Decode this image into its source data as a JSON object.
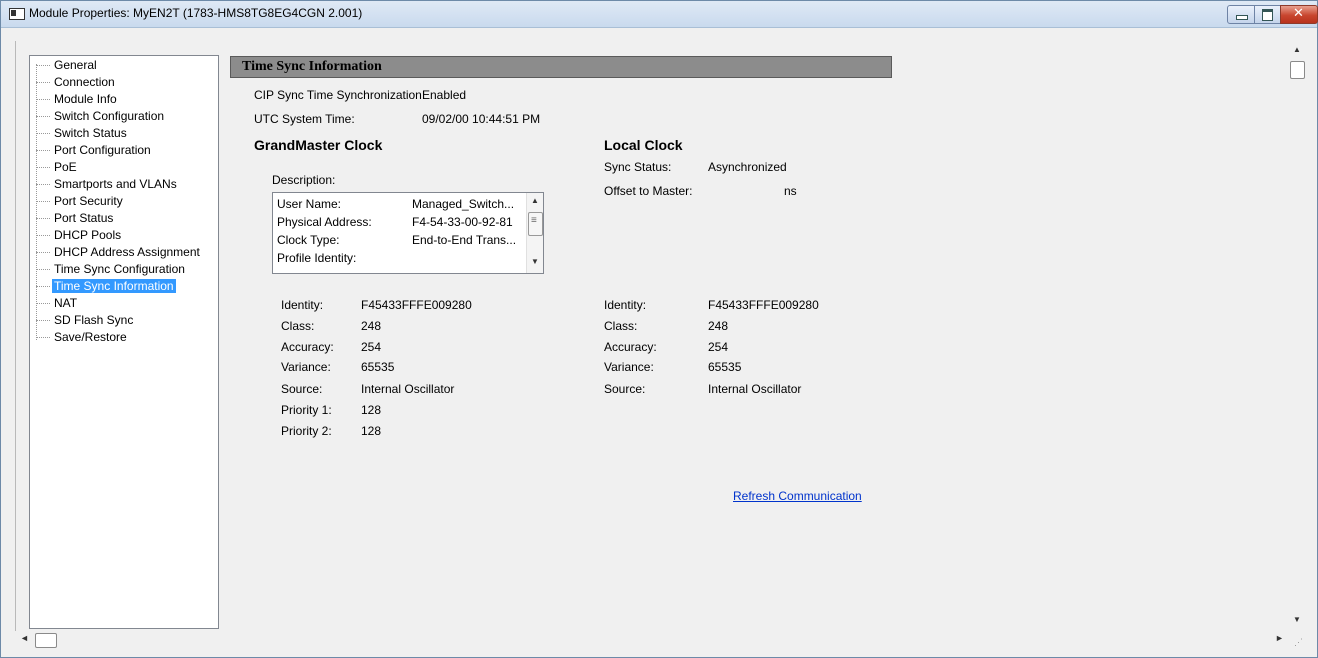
{
  "window": {
    "title": "Module Properties: MyEN2T (1783-HMS8TG8EG4CGN 2.001)",
    "close_glyph": "✕"
  },
  "sidebar": {
    "items": [
      {
        "label": "General"
      },
      {
        "label": "Connection"
      },
      {
        "label": "Module Info"
      },
      {
        "label": "Switch Configuration"
      },
      {
        "label": "Switch Status"
      },
      {
        "label": "Port Configuration"
      },
      {
        "label": "PoE"
      },
      {
        "label": "Smartports and VLANs"
      },
      {
        "label": "Port Security"
      },
      {
        "label": "Port Status"
      },
      {
        "label": "DHCP Pools"
      },
      {
        "label": "DHCP Address Assignment"
      },
      {
        "label": "Time Sync Configuration"
      },
      {
        "label": "Time Sync Information",
        "selected": true
      },
      {
        "label": "NAT"
      },
      {
        "label": "SD Flash Sync"
      },
      {
        "label": "Save/Restore"
      }
    ]
  },
  "main": {
    "section_title": "Time Sync Information",
    "cip_sync_label": "CIP Sync Time Synchronization:",
    "cip_sync_value": "Enabled",
    "utc_label": "UTC System Time:",
    "utc_value": "09/02/00 10:44:51 PM",
    "grandmaster": {
      "heading": "GrandMaster Clock",
      "description_label": "Description:",
      "description_rows": [
        {
          "label": "User Name:",
          "value": "Managed_Switch..."
        },
        {
          "label": "Physical Address:",
          "value": "F4-54-33-00-92-81"
        },
        {
          "label": "Clock Type:",
          "value": "End-to-End Trans..."
        },
        {
          "label": "Profile Identity:",
          "value": ""
        }
      ],
      "fields": [
        {
          "label": "Identity:",
          "value": "F45433FFFE009280"
        },
        {
          "label": "Class:",
          "value": "248"
        },
        {
          "label": "Accuracy:",
          "value": "254"
        },
        {
          "label": "Variance:",
          "value": "65535"
        },
        {
          "label": "Source:",
          "value": "Internal Oscillator"
        },
        {
          "label": "Priority 1:",
          "value": "128"
        },
        {
          "label": "Priority 2:",
          "value": "128"
        }
      ]
    },
    "local": {
      "heading": "Local Clock",
      "sync_status_label": "Sync Status:",
      "sync_status_value": "Asynchronized",
      "offset_label": "Offset to Master:",
      "offset_unit": "ns",
      "fields": [
        {
          "label": "Identity:",
          "value": "F45433FFFE009280"
        },
        {
          "label": "Class:",
          "value": "248"
        },
        {
          "label": "Accuracy:",
          "value": "254"
        },
        {
          "label": "Variance:",
          "value": "65535"
        },
        {
          "label": "Source:",
          "value": "Internal Oscillator"
        }
      ]
    },
    "refresh_label": "Refresh Communication"
  }
}
